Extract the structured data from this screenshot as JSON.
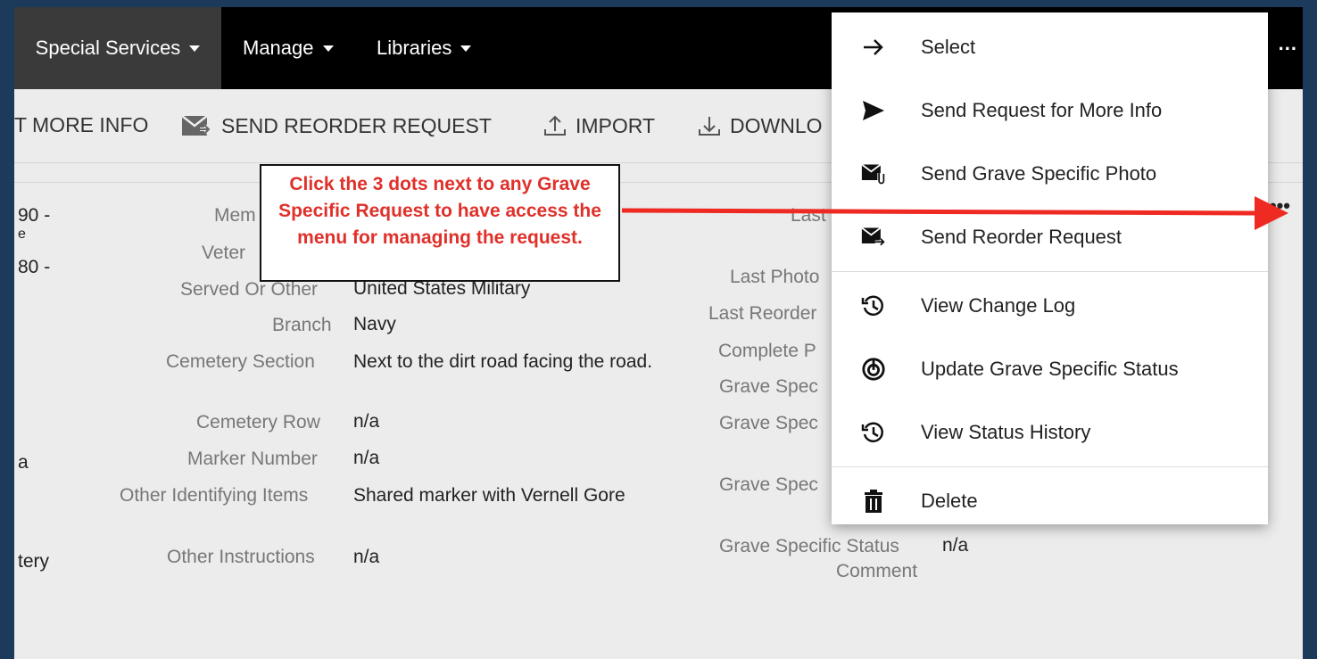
{
  "nav": {
    "items": [
      "Special Services",
      "Manage",
      "Libraries"
    ],
    "more": "..."
  },
  "toolbar": {
    "more_info": "T MORE INFO",
    "send_reorder": "SEND REORDER REQUEST",
    "import": "IMPORT",
    "download": "DOWNLO"
  },
  "left_fragments": [
    "90 -",
    "e",
    "80 -",
    "a",
    "tery"
  ],
  "details": {
    "memorial_label_partial": "Mem",
    "veteran_label_partial": "Veter",
    "served_label": "Served Or Other",
    "served_value": "United States Military",
    "branch_label": "Branch",
    "branch_value": "Navy",
    "section_label": "Cemetery Section",
    "section_value": "Next to the dirt road facing the road.",
    "row_label": "Cemetery Row",
    "row_value": "n/a",
    "marker_label": "Marker Number",
    "marker_value": "n/a",
    "other_items_label": "Other Identifying Items",
    "other_items_value": "Shared marker with Vernell Gore",
    "instructions_label": "Other Instructions",
    "instructions_value": "n/a"
  },
  "right_details": {
    "last_label_partial": "Last",
    "last_photo_partial": "Last Photo",
    "last_reorder_partial": "Last Reorder",
    "complete_partial": "Complete P",
    "grave_spec_1": "Grave Spec",
    "grave_spec_2": "Grave Spec",
    "grave_spec_3": "Grave Spec",
    "status_comment_label_1": "Grave Specific Status",
    "status_comment_label_2": "Comment",
    "status_comment_value": "n/a"
  },
  "row_more": "•••",
  "callout": {
    "text": "Click the 3 dots next to any Grave Specific Request to have access the menu for managing the request.",
    "color": "#e0302a"
  },
  "menu": {
    "items": [
      {
        "label": "Select",
        "icon": "arrow-right-icon"
      },
      {
        "label": "Send Request for More Info",
        "icon": "send-icon"
      },
      {
        "label": "Send Grave Specific Photo",
        "icon": "mail-attachment-icon"
      },
      {
        "label": "Send Reorder Request",
        "icon": "mail-forward-icon"
      },
      {
        "label": "View Change Log",
        "icon": "history-icon"
      },
      {
        "label": "Update Grave Specific Status",
        "icon": "status-update-icon"
      },
      {
        "label": "View Status History",
        "icon": "history-icon"
      },
      {
        "label": "Delete",
        "icon": "trash-icon"
      }
    ]
  }
}
